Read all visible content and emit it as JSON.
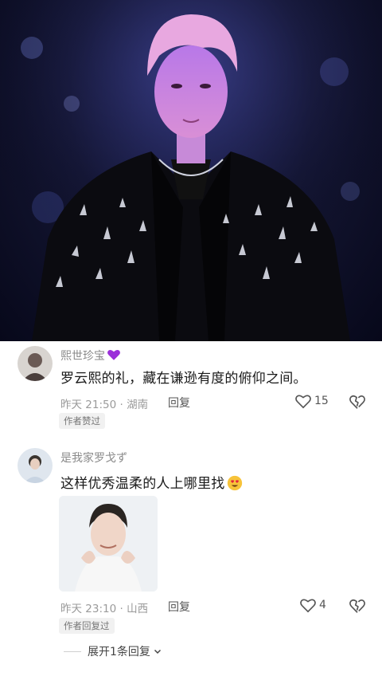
{
  "comments": [
    {
      "username": "熙世珍宝",
      "badge_icon": "purple-heart-icon",
      "text": "罗云熙的礼，藏在谦逊有度的俯仰之间。",
      "time": "昨天 21:50",
      "location": "湖南",
      "reply_label": "回复",
      "like_count": "15",
      "tag": "作者赞过"
    },
    {
      "username": "是我家罗戈ず",
      "text": "这样优秀温柔的人上哪里找",
      "emoji_icon": "heart-eyes-emoji-icon",
      "time": "昨天 23:10",
      "location": "山西",
      "reply_label": "回复",
      "like_count": "4",
      "tag": "作者回复过"
    }
  ],
  "expand_replies_label": "展开1条回复",
  "colors": {
    "accent_purple": "#9b30d9",
    "meta_gray": "#9a9a9a",
    "tag_bg": "#f1f1f1"
  }
}
